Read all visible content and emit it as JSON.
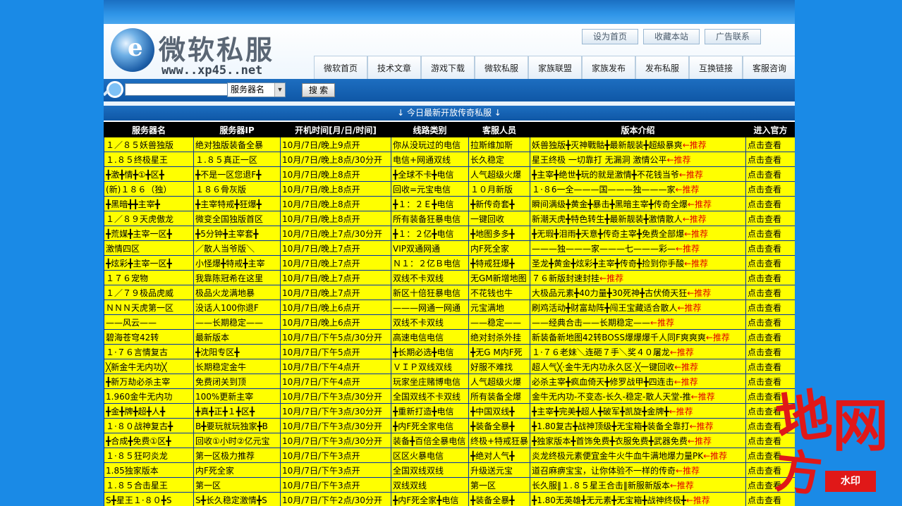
{
  "header": {
    "logo_title": "微软私服",
    "logo_url": "www..xp45..net",
    "top_links": [
      "设为首页",
      "收藏本站",
      "广告联系"
    ],
    "nav": [
      "微软首页",
      "技术文章",
      "游戏下载",
      "微软私服",
      "家族联盟",
      "家族发布",
      "发布私服",
      "互换链接",
      "客服咨询"
    ]
  },
  "search": {
    "input_value": "",
    "select_value": "服务器名",
    "button_label": "搜 索"
  },
  "section_title": "↓ 今日最新开放传奇私服 ↓",
  "table": {
    "columns": [
      "服务器名",
      "服务器IP",
      "开机时间[月/日/时间]",
      "线路类别",
      "客服人员",
      "版本介绍",
      "进入官方"
    ],
    "rows": [
      [
        "１／８５妖兽独版",
        "绝对独版装备全暴",
        "10月/7日/晚上9点开",
        "你从没玩过的电信",
        "拉斯维加斯",
        "妖兽独版╋灭神戰骷╋最新靓装╋超級暴爽",
        "←推荐",
        "点击查看"
      ],
      [
        "１.８５终极星王",
        "１.８５真正一区",
        "10月/7日/晚上8点/30分开",
        "电信+网通双线",
        "长久稳定",
        "星王终极 一切靠打 无漏洞 激情公平",
        "←推荐",
        "点击查看"
      ],
      [
        "╋激╋情╋①╋区╋",
        "╋不是一区您退F╋",
        "10月/7日/晚上8点开",
        "╋全球不卡╋电信",
        "人气超级火爆",
        "╋主宰╋绝世╋玩的就是激情╋不花钱当爷",
        "←推荐",
        "点击查看"
      ],
      [
        "(新)１８６（独）",
        "１８６骨灰版",
        "10月/7日/晚上8点开",
        "回收=元宝电信",
        "１０月新版",
        "１·８6一全———国———独———家",
        "←推荐",
        "点击查看"
      ],
      [
        "╋黑暗╋╋主宰╋",
        "╋主宰特戒╋狂爆╋",
        "10月/7日/晚上8点开",
        "╋１：２Ｅ╋电信",
        "╋新传奇套╋",
        "瞬间满级╋黄金╋暴击╋黑暗主宰╋传奇全爆",
        "←推荐",
        "点击查看"
      ],
      [
        "１／８９天虎傲龙",
        "微变全国独版首区",
        "10月/7日/晚上8点开",
        "所有装备狂暴电信",
        "一键回收",
        "新潮天虎╋特色转生╋最新靓装╋激情散人",
        "←推荐",
        "点击查看"
      ],
      [
        "╋荒媒╋主宰一区╋",
        "╋5分钟╋主宰套╋",
        "10月/7日/晚上7点/30分开",
        "╋１：２亿╋电信",
        "╋地图多多╋",
        "╋无瑕╋泪雨╋天意╋传奇主宰╋免费全部爆",
        "←推荐",
        "点击查看"
      ],
      [
        "激情四区",
        "／散人当爷版＼",
        "10月/7日/晚上7点开",
        "VIP双通网通",
        "内F死全家",
        "———独———家———七———彩—",
        "←推荐",
        "点击查看"
      ],
      [
        "╋炫彩╋主宰一区╋",
        "小怪爆╋特戒╋主宰",
        "10月/7日/晚上7点开",
        "Ｎ１：２亿Ｂ电信",
        "╋特戒狂爆╋",
        "圣龙╋黄金╋炫彩╋主宰╋传奇╋捡到你手酸",
        "←推荐",
        "点击查看"
      ],
      [
        "１７６宠物",
        "我靠陈冠希在这里",
        "10月/7日/晚上7点开",
        "双线不卡双线",
        "无GM新增地图",
        "７６新版封速封挂",
        "←推荐",
        "点击查看"
      ],
      [
        "１／７９极品虎威",
        "极品火龙满地暴",
        "10月/7日/晚上7点开",
        "新区十倍狂暴电信",
        "不花钱也牛",
        "大极品元素╋40力量╋30死神╋古伏倚天狂",
        "←推荐",
        "点击查看"
      ],
      [
        "ＮＮＮ天虎第一区",
        "没话人100你退F",
        "10月/7日/晚上6点开",
        "———网通一网通",
        "元宝满地",
        "刷鸡活动╋财富劫阵╋闯王宝藏适合散人",
        "←推荐",
        "点击查看"
      ],
      [
        "——风云——",
        "——长期稳定——",
        "10月/7日/晚上6点开",
        "双线不卡双线",
        "——稳定——",
        "——经典合击——长期稳定——",
        "←推荐",
        "点击查看"
      ],
      [
        "碧海苍穹42转",
        "最新版本",
        "10月/7日/下午5点/30分开",
        "高速电信电信",
        "绝对封杀外挂",
        "新装备新地图42转BOSS爆爆爆千人同F爽爽爽",
        "←推荐",
        "点击查看"
      ],
      [
        "１·７６言情复古",
        "╋沈阳专区╋",
        "10月/7日/下午5点开",
        "╋长期必选╋电信",
        "╋无G M内F死",
        "１·７６老妹＼连砸７手＼奖４０屠龙",
        "←推荐",
        "点击查看"
      ],
      [
        "╳新金牛无内功╳",
        "长期稳定金牛",
        "10月/7日/下午4点开",
        "ＶＩＰ双线双线",
        "好服不难找",
        "超人气╳·金牛无内功永久区·╳一键回收",
        "←推荐",
        "点击查看"
      ],
      [
        "╋新万劫必杀主宰",
        "免费闭关到顶",
        "10月/7日/下午4点开",
        "玩家坐庄赌博电信",
        "人气超级火爆",
        "必杀主宰╋疯血倚天╋修罗战甲╋四连击",
        "←推荐",
        "点击查看"
      ],
      [
        "1.960金牛无内功",
        "100%更新主宰",
        "10月/7日/下午3点/30分开",
        "全国双线不卡双线",
        "所有装备全爆",
        "金牛无内功-不变态-长久-稳定-散人天堂-推",
        "←推荐",
        "点击查看"
      ],
      [
        "╋金╋牌╋超╋人╋",
        "╋真╋正╋１╋区╋",
        "10月/7日/下午3点/30分开",
        "╋重新打造╋电信",
        "╋中国双线╋",
        "╋主宰╋完美╋超人╋破军╋凯旋╋金牌╋",
        "←推荐",
        "点击查看"
      ],
      [
        "１·８０战神复古╋",
        "B╋要玩就玩独家╋B",
        "10月/7日/下午3点/30分开",
        "╋内F死全家电信",
        "╋装备全暴╋",
        "╋1.80复古╋战神顶级╋无宝箱╋装备全靠打",
        "←推荐",
        "点击查看"
      ],
      [
        "╋合成╋免费①区╋",
        "回收①小时②亿元宝",
        "10月/7日/下午3点/30分开",
        "装备╋百倍全暴电信",
        "终极+特戒狂暴",
        "╋独家版本╋首饰免费╋衣服免费╋武器免费",
        "←推荐",
        "点击查看"
      ],
      [
        "１·８５狂叼炎龙",
        "第一区极力推荐",
        "10月/7日/下午3点开",
        "区区火暴电信",
        "╋绝对人气╋",
        "炎龙终极元素便宜金牛火牛血牛满地爆力量PK",
        "←推荐",
        "点击查看"
      ],
      [
        "1.85独家版本",
        "内F死全家",
        "10月/7日/下午3点开",
        "全国双线双线",
        "升级送元宝",
        "道召麻痹宝宝，让你体验不一样的传奇",
        "←推荐",
        "点击查看"
      ],
      [
        "１.８５合击星王",
        "第一区",
        "10月/7日/下午3点开",
        "双线双线",
        "第一区",
        "长久服‖１.８５星王合击‖新服新版本",
        "←推荐",
        "点击查看"
      ],
      [
        "S╋星王１·８０╋S",
        "S╋长久稳定激情╋S",
        "10月/7日/下午2点/30分开",
        "╋内F死全家╋电信",
        "╋装备全暴╋",
        "╋1.80无英雄╋无元素╋无宝箱╋战神终极╋",
        "←推荐",
        "点击查看"
      ]
    ]
  },
  "watermark": {
    "chars": [
      "地",
      "网",
      "方"
    ],
    "badge": "水印"
  }
}
